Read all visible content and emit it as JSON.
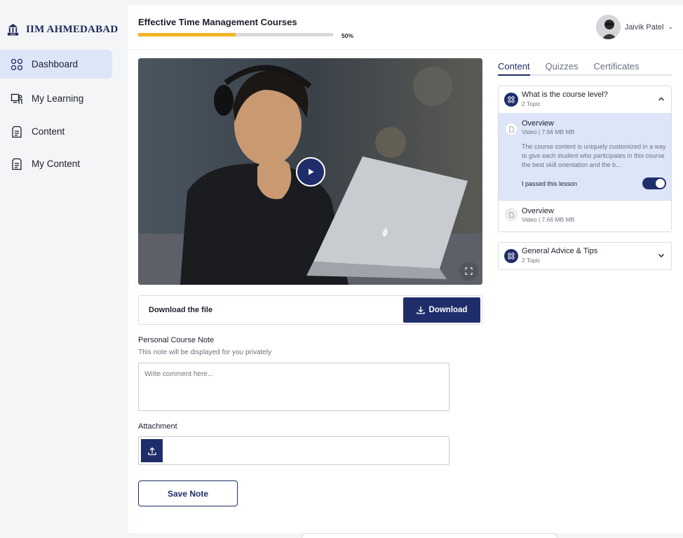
{
  "brand": {
    "name": "IIM AHMEDABAD",
    "logo_text": "IIMA"
  },
  "sidebar": {
    "items": [
      {
        "label": "Dashboard",
        "icon": "grid-icon",
        "active": true
      },
      {
        "label": "My Learning",
        "icon": "learning-board-icon",
        "active": false
      },
      {
        "label": "Content",
        "icon": "document-icon",
        "active": false
      },
      {
        "label": "My Content",
        "icon": "document-icon",
        "active": false
      }
    ]
  },
  "header": {
    "course_title": "Effective Time Management Courses",
    "progress": 0.5,
    "progress_label": "50%",
    "user_name": "Jaivik Patel"
  },
  "video": {
    "play_icon": "play-icon",
    "fullscreen_icon": "fullscreen-icon"
  },
  "download": {
    "label": "Download the file",
    "button_label": "Download"
  },
  "note": {
    "title": "Personal Course Note",
    "subtitle": "This note will be displayed for you privately",
    "placeholder": "Write comment here..."
  },
  "attachment": {
    "title": "Attachment"
  },
  "save_label": "Save Note",
  "tabs": [
    {
      "label": "Content",
      "active": true
    },
    {
      "label": "Quizzes",
      "active": false
    },
    {
      "label": "Certificates",
      "active": false
    }
  ],
  "sections": [
    {
      "title": "What is the course level?",
      "subtitle": "2 Topic",
      "expanded": true,
      "lessons": [
        {
          "title": "Overview",
          "meta": "Video | 7.66 MB MB",
          "description": "The course content is uniquely customized in a way to give each student who participates in this course the best skill orientation and the b...",
          "passed_label": "I passed this lesson",
          "passed": true
        },
        {
          "title": "Overview",
          "meta": "Video | 7.66 MB MB"
        }
      ]
    },
    {
      "title": "General Advice & Tips",
      "subtitle": "2 Topic",
      "expanded": false
    }
  ],
  "colors": {
    "primary": "#1f2d6b",
    "accent": "#f0b428",
    "active_bg": "#dde6f9"
  }
}
